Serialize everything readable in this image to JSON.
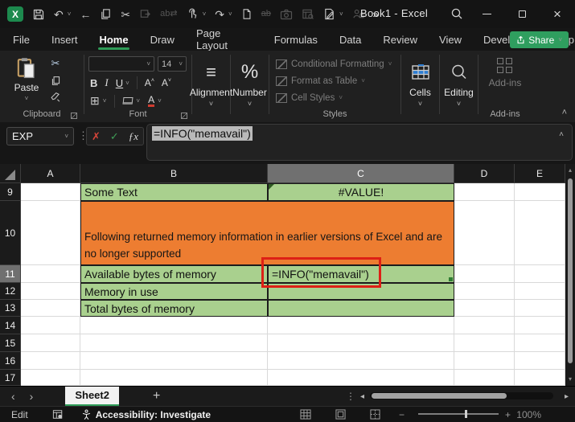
{
  "colors": {
    "accent_green": "#2e9b57",
    "share_green": "#2f9e5f",
    "cell_green": "#a9d08e",
    "cell_orange": "#ed7d31",
    "annotation_red": "#dd2016",
    "selected_header": "#707070"
  },
  "icons": {
    "excel_x": "X",
    "undo": "↶",
    "redo": "↷",
    "back": "←",
    "cut": "✂",
    "replace_ab": "ab",
    "swap": "⇄",
    "strike_ab": "ab",
    "more": "»",
    "chevron_down": "˅",
    "chevron_up": "˄",
    "close": "×",
    "ellipsis_v": "⋮",
    "cancel": "✗",
    "enter": "✓",
    "fx": "ƒx",
    "align": "≡",
    "percent": "%",
    "borders": "⊞",
    "bold": "B",
    "italic": "I",
    "underline": "U",
    "font_letter": "A",
    "sheet_prev": "‹",
    "sheet_next": "›",
    "scroll_left": "◂",
    "scroll_right": "▸",
    "scroll_up": "▴",
    "scroll_down": "▾",
    "add_sheet": "+",
    "zoom_out": "−",
    "zoom_in": "+"
  },
  "titlebar": {
    "app_title": "Book1  -  Excel"
  },
  "tabs": {
    "items": [
      "File",
      "Insert",
      "Home",
      "Draw",
      "Page Layout",
      "Formulas",
      "Data",
      "Review",
      "View",
      "Developer",
      "Help"
    ],
    "active": "Home",
    "share_label": "Share"
  },
  "ribbon": {
    "clipboard": {
      "paste_label": "Paste",
      "group_label": "Clipboard"
    },
    "font": {
      "group_label": "Font",
      "size_value": "14"
    },
    "alignment": {
      "label": "Alignment"
    },
    "number": {
      "label": "Number"
    },
    "styles": {
      "group_label": "Styles",
      "items": [
        "Conditional Formatting",
        "Format as Table",
        "Cell Styles"
      ]
    },
    "cells": {
      "label": "Cells"
    },
    "editing": {
      "label": "Editing"
    },
    "addins": {
      "button_label": "Add-ins",
      "group_label": "Add-ins"
    }
  },
  "formula_bar": {
    "name_box_value": "EXP",
    "formula": "=INFO(\"memavail\")"
  },
  "grid": {
    "columns": [
      "A",
      "B",
      "C",
      "D",
      "E"
    ],
    "rows": [
      "9",
      "10",
      "11",
      "12",
      "13",
      "14",
      "15",
      "16",
      "17"
    ],
    "cells": {
      "b9": "Some Text",
      "c9": "#VALUE!",
      "b10_merged": "Following returned memory information in earlier versions of Excel and are no longer supported",
      "b11": "Available bytes of memory",
      "c11": "=INFO(\"memavail\")",
      "b12": "Memory in use",
      "b13": "Total bytes of memory"
    }
  },
  "sheet_bar": {
    "active_tab": "Sheet2"
  },
  "status_bar": {
    "mode": "Edit",
    "accessibility": "Accessibility: Investigate",
    "zoom_level": "100%"
  }
}
